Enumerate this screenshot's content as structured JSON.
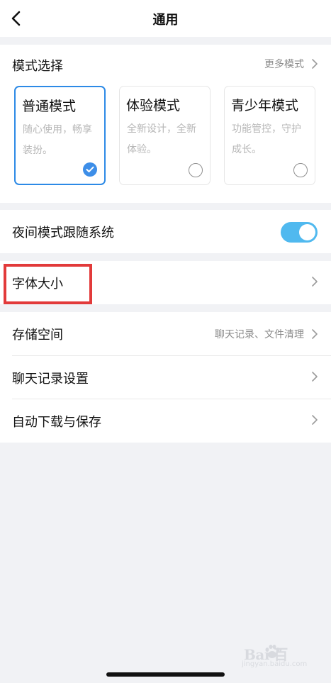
{
  "header": {
    "title": "通用",
    "back_icon": "back-chevron-icon"
  },
  "mode_section": {
    "title": "模式选择",
    "more_label": "更多模式",
    "options": [
      {
        "title": "普通模式",
        "desc_line1": "随心使用，畅享",
        "desc_line2": "装扮。",
        "selected": true
      },
      {
        "title": "体验模式",
        "desc_line1": "全新设计，全新",
        "desc_line2": "体验。",
        "selected": false
      },
      {
        "title": "青少年模式",
        "desc_line1": "功能管控，守护",
        "desc_line2": "成长。",
        "selected": false
      }
    ]
  },
  "night_mode": {
    "label": "夜间模式跟随系统",
    "enabled": true
  },
  "font_size": {
    "label": "字体大小"
  },
  "storage_group": {
    "items": [
      {
        "label": "存储空间",
        "detail": "聊天记录、文件清理"
      },
      {
        "label": "聊天记录设置",
        "detail": ""
      },
      {
        "label": "自动下载与保存",
        "detail": ""
      }
    ]
  },
  "watermark": {
    "brand": "Bai 百",
    "sub": "jingyan.baidu.com"
  },
  "colors": {
    "accent": "#3d8ee8",
    "toggle_on": "#50b9ef",
    "highlight": "#e23a3a",
    "background": "#f1f2f5",
    "secondary_text": "#8b8b8b",
    "description_text": "#b7b7b7"
  }
}
